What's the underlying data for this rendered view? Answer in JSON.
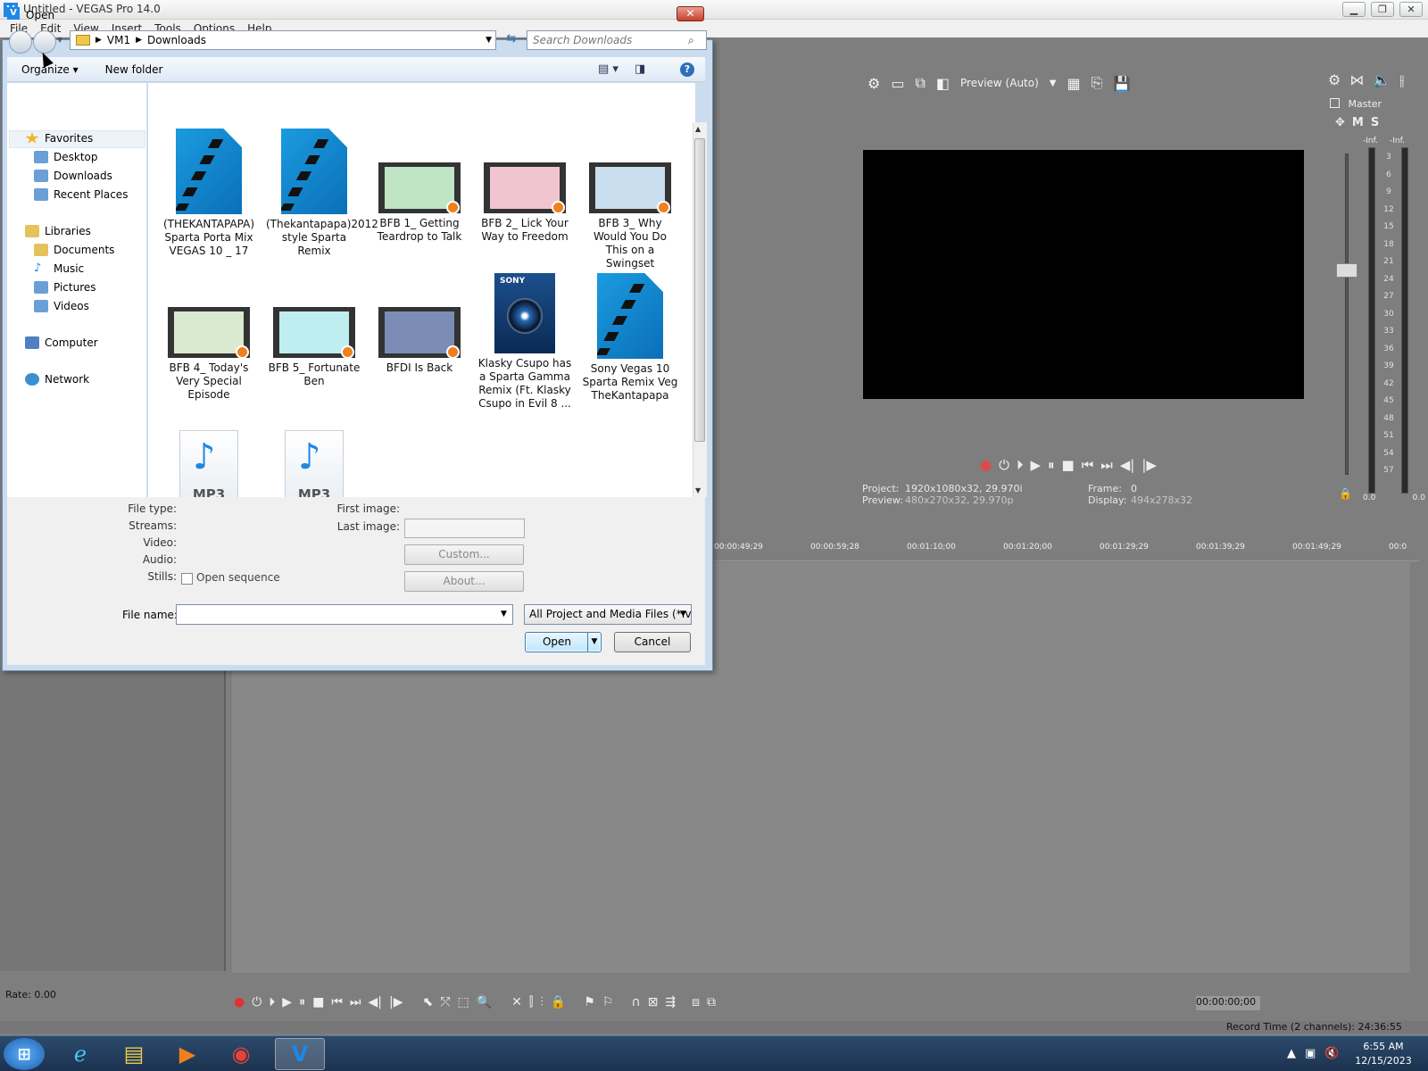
{
  "app": {
    "title": "Untitled - VEGAS Pro 14.0",
    "icon": "vegas-app-icon",
    "menu": [
      "File",
      "Edit",
      "View",
      "Insert",
      "Tools",
      "Options",
      "Help"
    ]
  },
  "preview": {
    "mode_label": "Preview (Auto)",
    "project_label": "Project:",
    "project_value": "1920x1080x32, 29.970i",
    "preview_label": "Preview:",
    "preview_value": "480x270x32, 29.970p",
    "frame_label": "Frame:",
    "frame_value": "0",
    "display_label": "Display:",
    "display_value": "494x278x32"
  },
  "mixer": {
    "master_label": "Master",
    "m_label": "M",
    "s_label": "S",
    "inf_left": "-Inf.",
    "inf_right": "-Inf.",
    "scale": [
      "3",
      "6",
      "9",
      "12",
      "15",
      "18",
      "21",
      "24",
      "27",
      "30",
      "33",
      "36",
      "39",
      "42",
      "45",
      "48",
      "51",
      "54",
      "57"
    ],
    "value_left": "0.0",
    "value_right": "0.0"
  },
  "timeline": {
    "ruler": [
      "00:00:49;29",
      "00:00:59;28",
      "00:01:10;00",
      "00:01:20;00",
      "00:01:29;29",
      "00:01:39;29",
      "00:01:49;29",
      "00:0"
    ],
    "rate": "Rate: 0.00",
    "timecode": "00:00:00;00",
    "record_time": "Record Time (2 channels): 24:36:55"
  },
  "taskbar": {
    "time": "6:55 AM",
    "date": "12/15/2023"
  },
  "dialog": {
    "title": "Open",
    "close_label": "✕",
    "breadcrumb": [
      "VM1",
      "Downloads"
    ],
    "search_placeholder": "Search Downloads",
    "organize_label": "Organize",
    "new_folder_label": "New folder",
    "nav": {
      "favorites": "Favorites",
      "desktop": "Desktop",
      "downloads": "Downloads",
      "recent_places": "Recent Places",
      "libraries": "Libraries",
      "documents": "Documents",
      "music": "Music",
      "pictures": "Pictures",
      "videos": "Videos",
      "computer": "Computer",
      "network": "Network"
    },
    "files": [
      {
        "name": "(THEKANTAPAPA) Sparta Porta Mix VEGAS 10 _ 17",
        "type": "vegas-project"
      },
      {
        "name": "(Thekantapapa)2012 style Sparta Remix",
        "type": "vegas-project"
      },
      {
        "name": "BFB 1_ Getting Teardrop to Talk",
        "type": "video",
        "thumb_color": "#bfe5c4"
      },
      {
        "name": "BFB 2_ Lick Your Way to Freedom",
        "type": "video",
        "thumb_color": "#f1c5cf"
      },
      {
        "name": "BFB 3_ Why Would You Do This on a Swingset",
        "type": "video",
        "thumb_color": "#c9dff0"
      },
      {
        "name": "BFB 4_ Today's Very Special Episode",
        "type": "video",
        "thumb_color": "#d9ead0"
      },
      {
        "name": "BFB 5_ Fortunate Ben",
        "type": "video",
        "thumb_color": "#bfeef0"
      },
      {
        "name": "BFDI Is Back",
        "type": "video",
        "thumb_color": "#7c8db5"
      },
      {
        "name": "Klasky Csupo has a Sparta Gamma Remix (Ft. Klasky Csupo in Evil 8 ...",
        "type": "sony-media"
      },
      {
        "name": "Sony Vegas 10 Sparta Remix Veg TheKantapapa",
        "type": "vegas-project"
      },
      {
        "name": "",
        "type": "mp3"
      },
      {
        "name": "",
        "type": "mp3"
      }
    ],
    "mp3_label": "MP3",
    "sony_brand": "SONY",
    "details": {
      "file_type": "File type:",
      "streams": "Streams:",
      "video": "Video:",
      "audio": "Audio:",
      "stills": "Stills:",
      "open_sequence": "Open sequence",
      "first_image": "First image:",
      "last_image": "Last image:",
      "custom_button": "Custom...",
      "about_button": "About..."
    },
    "file_name_label": "File name:",
    "file_name_value": "",
    "file_type_value": "All Project and Media Files (*.ve",
    "open_button": "Open",
    "cancel_button": "Cancel"
  }
}
